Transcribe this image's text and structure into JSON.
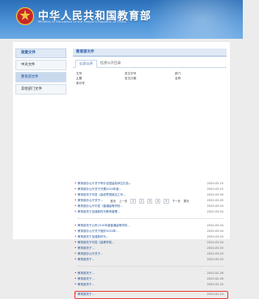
{
  "header": {
    "title": "中华人民共和国教育部",
    "subtitle": "Ministry of Education of the People's Republic of China",
    "emblem_icon": "national-emblem-icon",
    "colors": {
      "banner": "#3a80c8",
      "accent": "#1d4f99",
      "highlight": "#e53935"
    }
  },
  "sidebar": {
    "heading": "政策文件",
    "items": [
      {
        "label": "中央文件"
      },
      {
        "label": "教育部文件"
      },
      {
        "label": "其他部门文件"
      }
    ],
    "active_index": 1
  },
  "main": {
    "heading": "教育部文件",
    "tabs": [
      {
        "label": "公文公开"
      },
      {
        "label": "信息公开目录"
      }
    ],
    "active_tab": 0,
    "filters": {
      "r1": [
        "文号",
        "发文字号",
        "部门"
      ],
      "r2": [
        "主题",
        "发文日期",
        "名称"
      ],
      "r3": [
        "索引号"
      ]
    },
    "list1": [
      {
        "title": "教育部办公厅关于举办全国高校师生红色...",
        "date": "2020-03-10"
      },
      {
        "title": "教育部办公厅关于开展2020年度...",
        "date": "2020-03-10"
      },
      {
        "title": "教育部关于印发《高校思想政治工作...",
        "date": "2020-03-09"
      },
      {
        "title": "教育部办公厅关于...",
        "date": "2020-03-05"
      },
      {
        "title": "教育部办公厅印发《普通高等学校...",
        "date": "2020-03-04"
      },
      {
        "title": "教育部关于加强新时代教育管理...",
        "date": "2020-03-04"
      }
    ],
    "list2": [
      {
        "title": "教育部关于公布2019年度普通高等学校...",
        "date": "2020-03-04"
      },
      {
        "title": "教育部办公厅关于做好2020年...",
        "date": "2020-03-04"
      },
      {
        "title": "教育部关于加强新时代...",
        "date": "2020-03-04"
      },
      {
        "title": "教育部关于印发《高等学校...",
        "date": "2020-03-04"
      },
      {
        "title": "教育部关于...",
        "date": "2020-03-03"
      },
      {
        "title": "教育部办公厅关于...",
        "date": "2020-03-03"
      },
      {
        "title": "教育部关于...",
        "date": "2020-03-03"
      }
    ],
    "list3": [
      {
        "title": "教育部关于...",
        "date": "2020-02-26"
      },
      {
        "title": "教育部关于...",
        "date": "2020-02-26"
      },
      {
        "title": "教育部关于...",
        "date": "2020-02-25"
      },
      {
        "title": "教育部关于...",
        "date": "2020-02-24"
      }
    ],
    "pager": {
      "first": "首页",
      "prev": "上一页",
      "pages": [
        "1",
        "2",
        "3",
        "4",
        "5"
      ],
      "next": "下一页",
      "last": "尾页"
    }
  }
}
